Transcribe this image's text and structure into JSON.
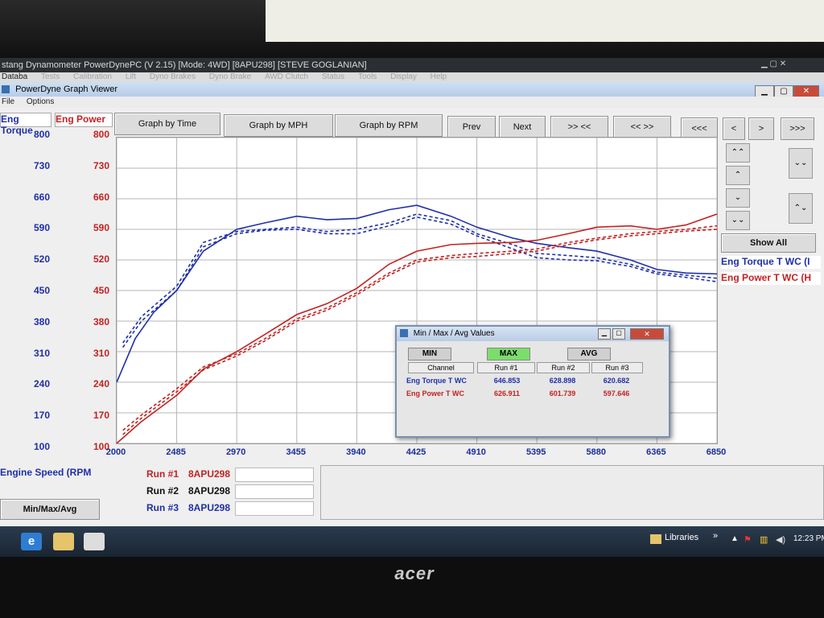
{
  "window": {
    "app_title": "stang Dynamometer PowerDynePC (V 2.15) [Mode: 4WD] [8APU298] [STEVE GOGLANIAN]",
    "app_menu": [
      "Databa",
      "Tests",
      "Calibration",
      "Lift",
      "Dyno Brakes",
      "Dyno Brake",
      "AWD Clutch",
      "Status",
      "Tools",
      "Display",
      "Help"
    ],
    "viewer_title": "PowerDyne Graph Viewer",
    "viewer_menu": [
      "File",
      "Options"
    ]
  },
  "axes": {
    "left_title": "Eng Torque",
    "right_title": "Eng Power",
    "y_ticks": [
      "800",
      "730",
      "660",
      "590",
      "520",
      "450",
      "380",
      "310",
      "240",
      "170",
      "100"
    ],
    "x_ticks": [
      "2000",
      "2485",
      "2970",
      "3455",
      "3940",
      "4425",
      "4910",
      "5395",
      "5880",
      "6365",
      "6850"
    ],
    "x_title": "Engine Speed (RPM"
  },
  "toolbar": {
    "graph_by_time": "Graph by Time",
    "graph_by_mph": "Graph by MPH",
    "graph_by_rpm": "Graph by RPM",
    "prev": "Prev",
    "next": "Next",
    "expand": ">> <<",
    "shrink": "<< >>",
    "left_fast": "<<<",
    "left": "<",
    "right": ">",
    "right_fast": ">>>"
  },
  "side_controls": {
    "show_all": "Show All",
    "legend_torque": "Eng Torque T WC (I",
    "legend_power": "Eng Power T WC (H"
  },
  "runs": {
    "run1_label": "Run #1",
    "run1_value": "8APU298",
    "run2_label": "Run #2",
    "run2_value": "8APU298",
    "run3_label": "Run #3",
    "run3_value": "8APU298",
    "minmax_button": "Min/Max/Avg"
  },
  "dialog": {
    "title": "Min / Max / Avg Values",
    "min": "MIN",
    "max": "MAX",
    "avg": "AVG",
    "headers": [
      "Channel",
      "Run #1",
      "Run #2",
      "Run #3"
    ],
    "rows": [
      {
        "channel": "Eng Torque T WC",
        "run1": "646.853",
        "run2": "628.898",
        "run3": "620.682"
      },
      {
        "channel": "Eng Power T WC",
        "run1": "626.911",
        "run2": "601.739",
        "run3": "597.646"
      }
    ]
  },
  "taskbar": {
    "libraries": "Libraries",
    "time": "12:23 PM"
  },
  "monitor": {
    "brand": "acer"
  },
  "colors": {
    "torque": "#1f2fa8",
    "power": "#c42222",
    "max_active": "#7bde6a"
  },
  "chart_data": {
    "type": "line",
    "x_range": [
      2000,
      6850
    ],
    "y_range": [
      100,
      800
    ],
    "series": [
      {
        "name": "Eng Torque T WC",
        "style": "solid",
        "color": "#1f2fa8",
        "x": [
          2000,
          2150,
          2300,
          2485,
          2700,
          2970,
          3200,
          3455,
          3700,
          3940,
          4200,
          4425,
          4700,
          4910,
          5200,
          5395,
          5650,
          5880,
          6150,
          6365,
          6600,
          6850
        ],
        "y": [
          240,
          340,
          400,
          450,
          540,
          590,
          605,
          620,
          612,
          615,
          635,
          645,
          620,
          595,
          570,
          558,
          548,
          540,
          520,
          498,
          490,
          488
        ]
      },
      {
        "name": "Eng Torque T WC",
        "style": "dashed",
        "color": "#1f2fa8",
        "x": [
          2050,
          2200,
          2485,
          2700,
          2970,
          3200,
          3455,
          3700,
          3940,
          4200,
          4425,
          4700,
          4910,
          5200,
          5395,
          5650,
          5880,
          6150,
          6365,
          6600,
          6850
        ],
        "y": [
          330,
          390,
          460,
          560,
          585,
          590,
          595,
          585,
          590,
          605,
          625,
          610,
          580,
          555,
          535,
          530,
          525,
          510,
          492,
          485,
          478
        ]
      },
      {
        "name": "Eng Torque T WC",
        "style": "dashed",
        "color": "#1f2fa8",
        "x": [
          2050,
          2200,
          2485,
          2700,
          2970,
          3200,
          3455,
          3700,
          3940,
          4200,
          4425,
          4700,
          4910,
          5200,
          5395,
          5650,
          5880,
          6150,
          6365,
          6600,
          6850
        ],
        "y": [
          320,
          380,
          450,
          550,
          580,
          588,
          590,
          580,
          580,
          598,
          618,
          602,
          575,
          545,
          525,
          520,
          518,
          505,
          488,
          480,
          470
        ]
      },
      {
        "name": "Eng Power T WC",
        "style": "solid",
        "color": "#c42222",
        "x": [
          2000,
          2200,
          2485,
          2700,
          2970,
          3200,
          3455,
          3700,
          3940,
          4200,
          4425,
          4700,
          4910,
          5200,
          5395,
          5650,
          5880,
          6150,
          6365,
          6600,
          6850
        ],
        "y": [
          100,
          150,
          210,
          270,
          310,
          350,
          395,
          420,
          455,
          510,
          540,
          555,
          558,
          560,
          565,
          580,
          595,
          598,
          590,
          600,
          625
        ]
      },
      {
        "name": "Eng Power T WC",
        "style": "dashed",
        "color": "#c42222",
        "x": [
          2050,
          2200,
          2485,
          2700,
          2970,
          3200,
          3455,
          3700,
          3940,
          4200,
          4425,
          4700,
          4910,
          5200,
          5395,
          5650,
          5880,
          6150,
          6365,
          6600,
          6850
        ],
        "y": [
          130,
          165,
          225,
          275,
          305,
          340,
          385,
          410,
          445,
          490,
          520,
          530,
          535,
          540,
          545,
          560,
          570,
          580,
          585,
          590,
          598
        ]
      },
      {
        "name": "Eng Power T WC",
        "style": "dashed",
        "color": "#c42222",
        "x": [
          2050,
          2200,
          2485,
          2700,
          2970,
          3200,
          3455,
          3700,
          3940,
          4200,
          4425,
          4700,
          4910,
          5200,
          5395,
          5650,
          5880,
          6150,
          6365,
          6600,
          6850
        ],
        "y": [
          120,
          158,
          218,
          268,
          300,
          335,
          380,
          405,
          440,
          485,
          515,
          525,
          528,
          535,
          540,
          555,
          566,
          575,
          580,
          586,
          590
        ]
      }
    ],
    "grid": true
  }
}
